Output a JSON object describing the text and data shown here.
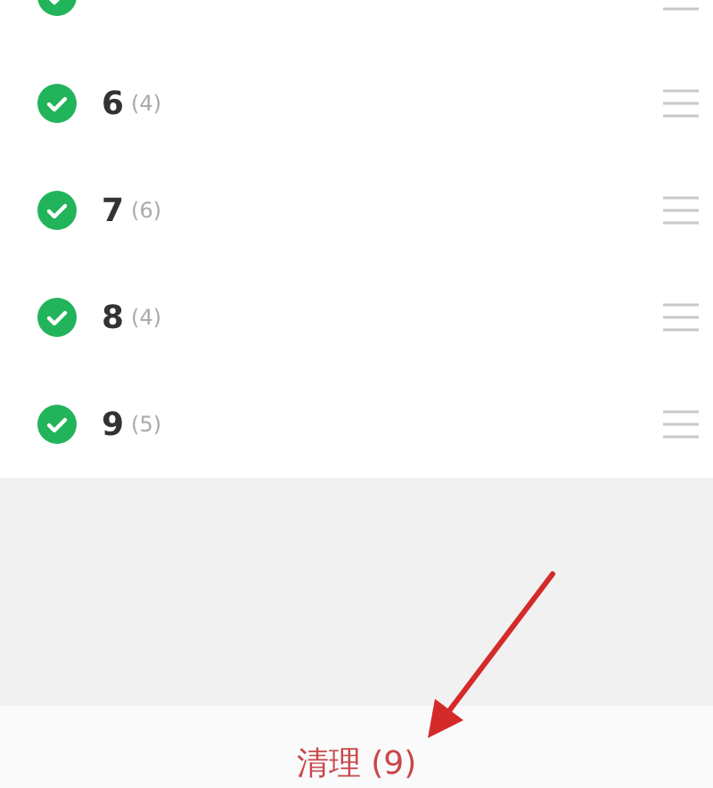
{
  "items": [
    {
      "checked": true
    },
    {
      "label": "6",
      "count": "(4)",
      "checked": true
    },
    {
      "label": "7",
      "count": "(6)",
      "checked": true
    },
    {
      "label": "8",
      "count": "(4)",
      "checked": true
    },
    {
      "label": "9",
      "count": "(5)",
      "checked": true
    }
  ],
  "clean_button": {
    "label": "清理 (9)"
  }
}
